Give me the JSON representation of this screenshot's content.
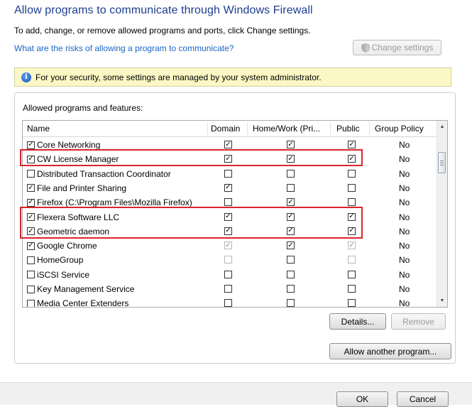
{
  "header": {
    "title": "Allow programs to communicate through Windows Firewall",
    "subtitle": "To add, change, or remove allowed programs and ports, click Change settings.",
    "risk_link": "What are the risks of allowing a program to communicate?",
    "change_settings_label": "Change settings"
  },
  "info_bar": {
    "icon": "info-icon",
    "text": "For your security, some settings are managed by your system administrator."
  },
  "group": {
    "label": "Allowed programs and features:"
  },
  "list": {
    "columns": [
      "Name",
      "Domain",
      "Home/Work (Pri...",
      "Public",
      "Group Policy"
    ],
    "rows": [
      {
        "name": "Core Networking",
        "enabled": true,
        "domain": true,
        "home": true,
        "public": true,
        "policy": "No",
        "faded_domain": false,
        "faded_public": false
      },
      {
        "name": "CW License Manager",
        "enabled": true,
        "domain": true,
        "home": true,
        "public": true,
        "policy": "No",
        "faded_domain": false,
        "faded_public": false
      },
      {
        "name": "Distributed Transaction Coordinator",
        "enabled": false,
        "domain": false,
        "home": false,
        "public": false,
        "policy": "No",
        "faded_domain": false,
        "faded_public": false
      },
      {
        "name": "File and Printer Sharing",
        "enabled": true,
        "domain": true,
        "home": false,
        "public": false,
        "policy": "No",
        "faded_domain": false,
        "faded_public": false
      },
      {
        "name": "Firefox (C:\\Program Files\\Mozilla Firefox)",
        "enabled": true,
        "domain": false,
        "home": true,
        "public": false,
        "policy": "No",
        "faded_domain": false,
        "faded_public": false
      },
      {
        "name": "Flexera Software LLC",
        "enabled": true,
        "domain": true,
        "home": true,
        "public": true,
        "policy": "No",
        "faded_domain": false,
        "faded_public": false
      },
      {
        "name": "Geometric daemon",
        "enabled": true,
        "domain": true,
        "home": true,
        "public": true,
        "policy": "No",
        "faded_domain": false,
        "faded_public": false
      },
      {
        "name": "Google Chrome",
        "enabled": true,
        "domain": true,
        "home": true,
        "public": true,
        "policy": "No",
        "faded_domain": true,
        "faded_public": true
      },
      {
        "name": "HomeGroup",
        "enabled": false,
        "domain": false,
        "home": false,
        "public": false,
        "policy": "No",
        "faded_domain": true,
        "faded_public": true
      },
      {
        "name": "iSCSI Service",
        "enabled": false,
        "domain": false,
        "home": false,
        "public": false,
        "policy": "No",
        "faded_domain": false,
        "faded_public": false
      },
      {
        "name": "Key Management Service",
        "enabled": false,
        "domain": false,
        "home": false,
        "public": false,
        "policy": "No",
        "faded_domain": false,
        "faded_public": false
      },
      {
        "name": "Media Center Extenders",
        "enabled": false,
        "domain": false,
        "home": false,
        "public": false,
        "policy": "No",
        "faded_domain": false,
        "faded_public": false
      }
    ]
  },
  "buttons": {
    "details": "Details...",
    "remove": "Remove",
    "allow_another": "Allow another program...",
    "ok": "OK",
    "cancel": "Cancel"
  },
  "colors": {
    "title": "#1e3d8f",
    "link": "#1a66c6",
    "info_bar_bg": "#fbf8c5",
    "highlight": "#d8262b"
  }
}
